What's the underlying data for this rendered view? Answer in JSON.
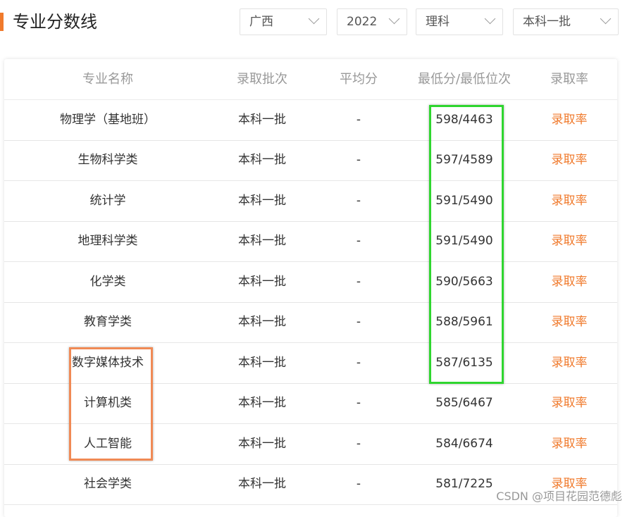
{
  "header": {
    "title": "专业分数线"
  },
  "filters": {
    "province": "广西",
    "year": "2022",
    "subject": "理科",
    "batch": "本科一批"
  },
  "table": {
    "columns": [
      "专业名称",
      "录取批次",
      "平均分",
      "最低分/最低位次",
      "录取率"
    ],
    "rows": [
      {
        "major": "物理学（基地班）",
        "batch": "本科一批",
        "avg": "-",
        "min": "598/4463",
        "rate": "录取率"
      },
      {
        "major": "生物科学类",
        "batch": "本科一批",
        "avg": "-",
        "min": "597/4589",
        "rate": "录取率"
      },
      {
        "major": "统计学",
        "batch": "本科一批",
        "avg": "-",
        "min": "591/5490",
        "rate": "录取率"
      },
      {
        "major": "地理科学类",
        "batch": "本科一批",
        "avg": "-",
        "min": "591/5490",
        "rate": "录取率"
      },
      {
        "major": "化学类",
        "batch": "本科一批",
        "avg": "-",
        "min": "590/5663",
        "rate": "录取率"
      },
      {
        "major": "教育学类",
        "batch": "本科一批",
        "avg": "-",
        "min": "588/5961",
        "rate": "录取率"
      },
      {
        "major": "数字媒体技术",
        "batch": "本科一批",
        "avg": "-",
        "min": "587/6135",
        "rate": "录取率"
      },
      {
        "major": "计算机类",
        "batch": "本科一批",
        "avg": "-",
        "min": "585/6467",
        "rate": "录取率"
      },
      {
        "major": "人工智能",
        "batch": "本科一批",
        "avg": "-",
        "min": "584/6674",
        "rate": "录取率"
      },
      {
        "major": "社会学类",
        "batch": "本科一批",
        "avg": "-",
        "min": "581/7225",
        "rate": "录取率"
      }
    ]
  },
  "watermark": "CSDN @项目花园范德彪",
  "colors": {
    "accent": "#f07a2c",
    "highlight_green": "#2fd62f",
    "highlight_orange": "#f08a55"
  },
  "icons": {
    "dropdown": "chevron-down-icon"
  }
}
